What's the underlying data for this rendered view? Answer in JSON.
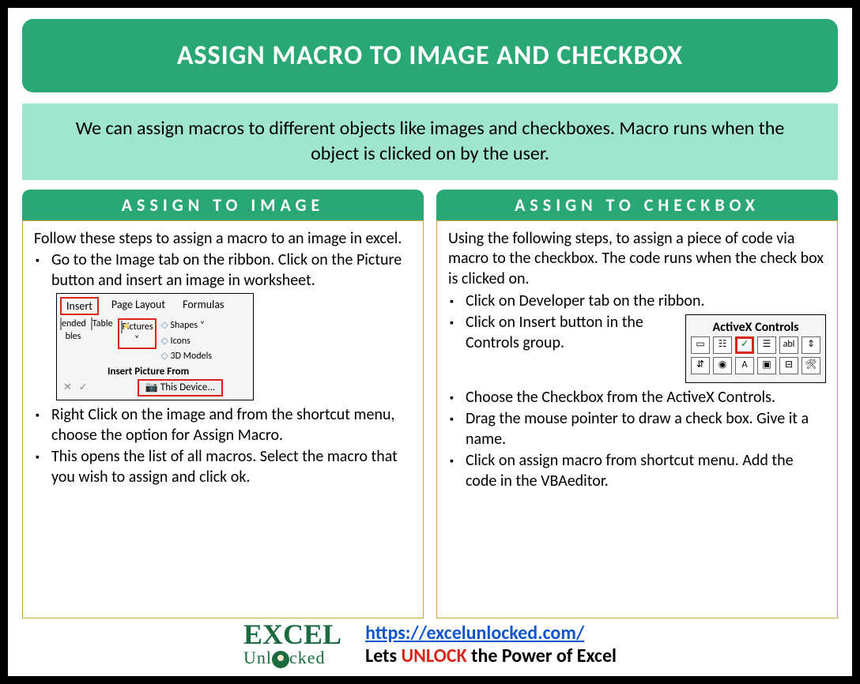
{
  "title": "ASSIGN MACRO TO IMAGE AND CHECKBOX",
  "intro": "We can assign macros to different objects like images and checkboxes. Macro runs when the object is clicked on by the user.",
  "left": {
    "header": "ASSIGN TO IMAGE",
    "lead": "Follow these steps to assign a macro to an image in excel.",
    "step1": "Go to the Image tab on the ribbon. Click on the Picture button and insert an image in worksheet.",
    "step2": "Right Click on the image and from the shortcut menu, choose the option for Assign Macro.",
    "step3": "This opens the list of all macros. Select the macro that you wish to assign and click ok.",
    "ribbon": {
      "tab_insert": "Insert",
      "tab_layout": "Page Layout",
      "tab_formulas": "Formulas",
      "ended": "ended",
      "bles": "bles",
      "table": "Table",
      "pictures": "Pictures",
      "shapes": "Shapes",
      "icons": "Icons",
      "models": "3D Models",
      "insert_from": "Insert Picture From",
      "this_device": "This Device..."
    }
  },
  "right": {
    "header": "ASSIGN TO CHECKBOX",
    "lead": "Using the following steps, to assign a piece of code via macro to the checkbox. The code runs when the check box is clicked on.",
    "step1": "Click on Developer tab on the ribbon.",
    "step2": "Click on Insert button in the Controls group.",
    "step3": "Choose the Checkbox from the ActiveX Controls.",
    "step4": "Drag the mouse pointer to draw a check box. Give it a name.",
    "step5": "Click on assign macro from shortcut menu. Add the code in the VBAeditor.",
    "activex_title": "ActiveX Controls"
  },
  "footer": {
    "logo_top": "EXCEL",
    "logo_bottom_pre": "Unl",
    "logo_bottom_post": "cked",
    "url": "https://excelunlocked.com/",
    "tagline_pre": "Lets ",
    "tagline_unlock": "UNLOCK",
    "tagline_post": " the Power of Excel"
  }
}
